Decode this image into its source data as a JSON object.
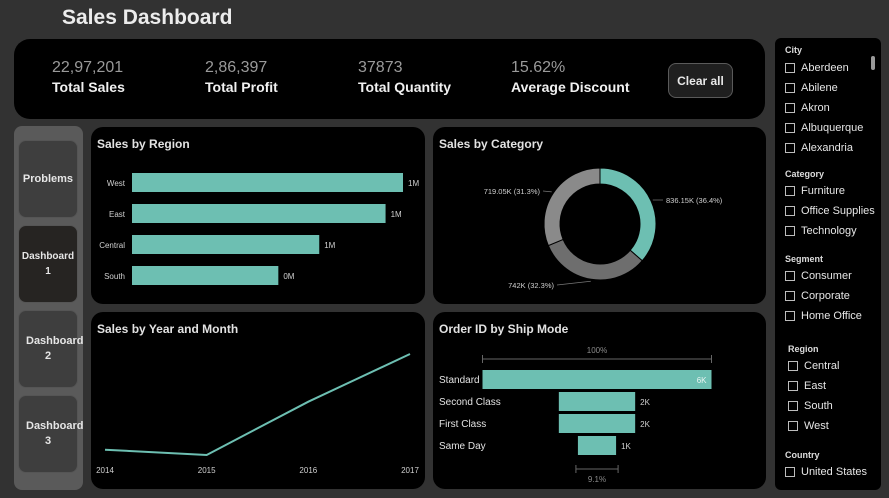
{
  "dashboard": {
    "title": "Sales Dashboard"
  },
  "kpis": [
    {
      "value": "22,97,201",
      "label": "Total Sales"
    },
    {
      "value": "2,86,397",
      "label": "Total Profit"
    },
    {
      "value": "37873",
      "label": "Total Quantity"
    },
    {
      "value": "15.62%",
      "label": "Average Discount"
    }
  ],
  "clear_button": "Clear all",
  "nav": [
    {
      "label": "Problems",
      "active": false
    },
    {
      "label": "Dashboard 1",
      "active": true
    },
    {
      "label": "Dashboard 2",
      "active": false
    },
    {
      "label": "Dashboard 3",
      "active": false
    }
  ],
  "slicers": {
    "city": {
      "title": "City",
      "items": [
        "Aberdeen",
        "Abilene",
        "Akron",
        "Albuquerque",
        "Alexandria"
      ]
    },
    "category": {
      "title": "Category",
      "items": [
        "Furniture",
        "Office Supplies",
        "Technology"
      ]
    },
    "segment": {
      "title": "Segment",
      "items": [
        "Consumer",
        "Corporate",
        "Home Office"
      ]
    },
    "region": {
      "title": "Region",
      "items": [
        "Central",
        "East",
        "South",
        "West"
      ]
    },
    "country": {
      "title": "Country",
      "items": [
        "United States"
      ]
    }
  },
  "colors": {
    "teal": "#6dbfb2",
    "dark_gray": "#6e6e6e",
    "light_gray": "#8a8a8a"
  },
  "chart_data": [
    {
      "type": "bar",
      "title": "Sales by Region",
      "categories": [
        "West",
        "East",
        "Central",
        "South"
      ],
      "values": [
        725458,
        678781,
        501240,
        391722
      ],
      "labels": [
        "1M",
        "1M",
        "1M",
        "0M"
      ],
      "xlim": [
        0,
        725458
      ]
    },
    {
      "type": "pie",
      "title": "Sales by Category",
      "labels": [
        "836.15K (36.4%)",
        "742K (32.3%)",
        "719.05K (31.3%)"
      ],
      "values": [
        836150,
        742000,
        719050
      ],
      "percents": [
        36.4,
        32.3,
        31.3
      ],
      "colors": [
        "#6dbfb2",
        "#6e6e6e",
        "#8a8a8a"
      ]
    },
    {
      "type": "line",
      "title": "Sales by Year and Month",
      "x": [
        "2014",
        "2015",
        "2016",
        "2017"
      ],
      "values": [
        484247,
        470533,
        609206,
        733215
      ],
      "ylim": [
        470533,
        733215
      ]
    },
    {
      "type": "bar",
      "title": "Order ID by Ship Mode",
      "categories": [
        "Standard Class",
        "Second Class",
        "First Class",
        "Same Day"
      ],
      "values": [
        6000,
        2000,
        2000,
        1000
      ],
      "labels": [
        "6K",
        "2K",
        "2K",
        "1K"
      ],
      "top_percent": "100%",
      "bottom_percent": "9.1%"
    }
  ]
}
